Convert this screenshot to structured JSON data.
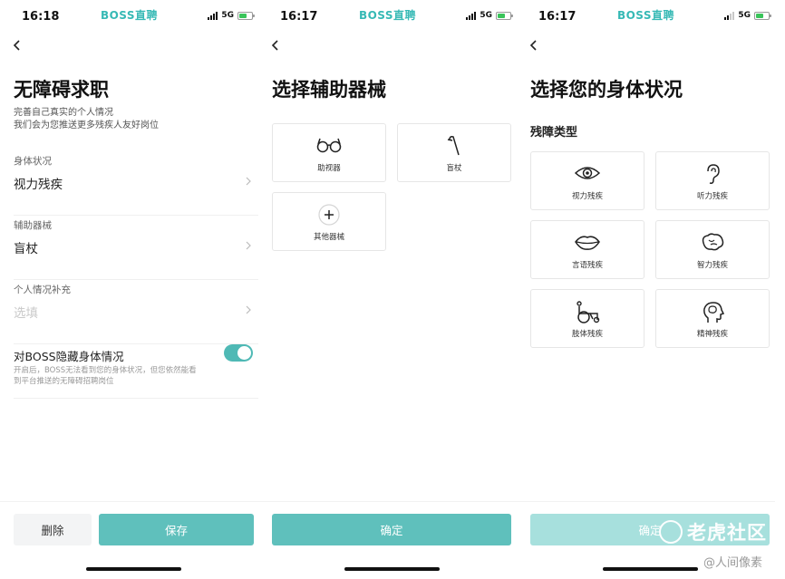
{
  "app": {
    "brand": "BOSS直聘",
    "network": "5G"
  },
  "screen1": {
    "time": "16:18",
    "title": "无障碍求职",
    "subtitle_line1": "完善自己真实的个人情况",
    "subtitle_line2": "我们会为您推送更多残疾人友好岗位",
    "fields": [
      {
        "label": "身体状况",
        "value": "视力残疾"
      },
      {
        "label": "辅助器械",
        "value": "盲杖"
      },
      {
        "label": "个人情况补充",
        "placeholder": "选填"
      }
    ],
    "toggle": {
      "label": "对BOSS隐藏身体情况",
      "desc": "开启后，BOSS无法看到您的身体状况，但您依然能看到平台推送的无障碍招聘岗位",
      "on": true
    },
    "delete_label": "删除",
    "save_label": "保存"
  },
  "screen2": {
    "time": "16:17",
    "title": "选择辅助器械",
    "items": [
      {
        "label": "助视器",
        "icon": "glasses-icon"
      },
      {
        "label": "盲杖",
        "icon": "cane-icon"
      },
      {
        "label": "其他器械",
        "icon": "plus-icon"
      }
    ],
    "confirm_label": "确定"
  },
  "screen3": {
    "time": "16:17",
    "title": "选择您的身体状况",
    "section": "残障类型",
    "items": [
      {
        "label": "视力残疾",
        "icon": "eye-icon"
      },
      {
        "label": "听力残疾",
        "icon": "ear-icon"
      },
      {
        "label": "言语残疾",
        "icon": "lips-icon"
      },
      {
        "label": "智力残疾",
        "icon": "brain-icon"
      },
      {
        "label": "肢体残疾",
        "icon": "wheelchair-icon"
      },
      {
        "label": "精神残疾",
        "icon": "head-brain-icon"
      }
    ],
    "confirm_label": "确定"
  },
  "watermark": {
    "text": "老虎社区",
    "handle": "@人间像素"
  },
  "colors": {
    "accent": "#5fc0bc",
    "brand": "#36b9b5",
    "accent_disabled": "#a7e0dd"
  }
}
